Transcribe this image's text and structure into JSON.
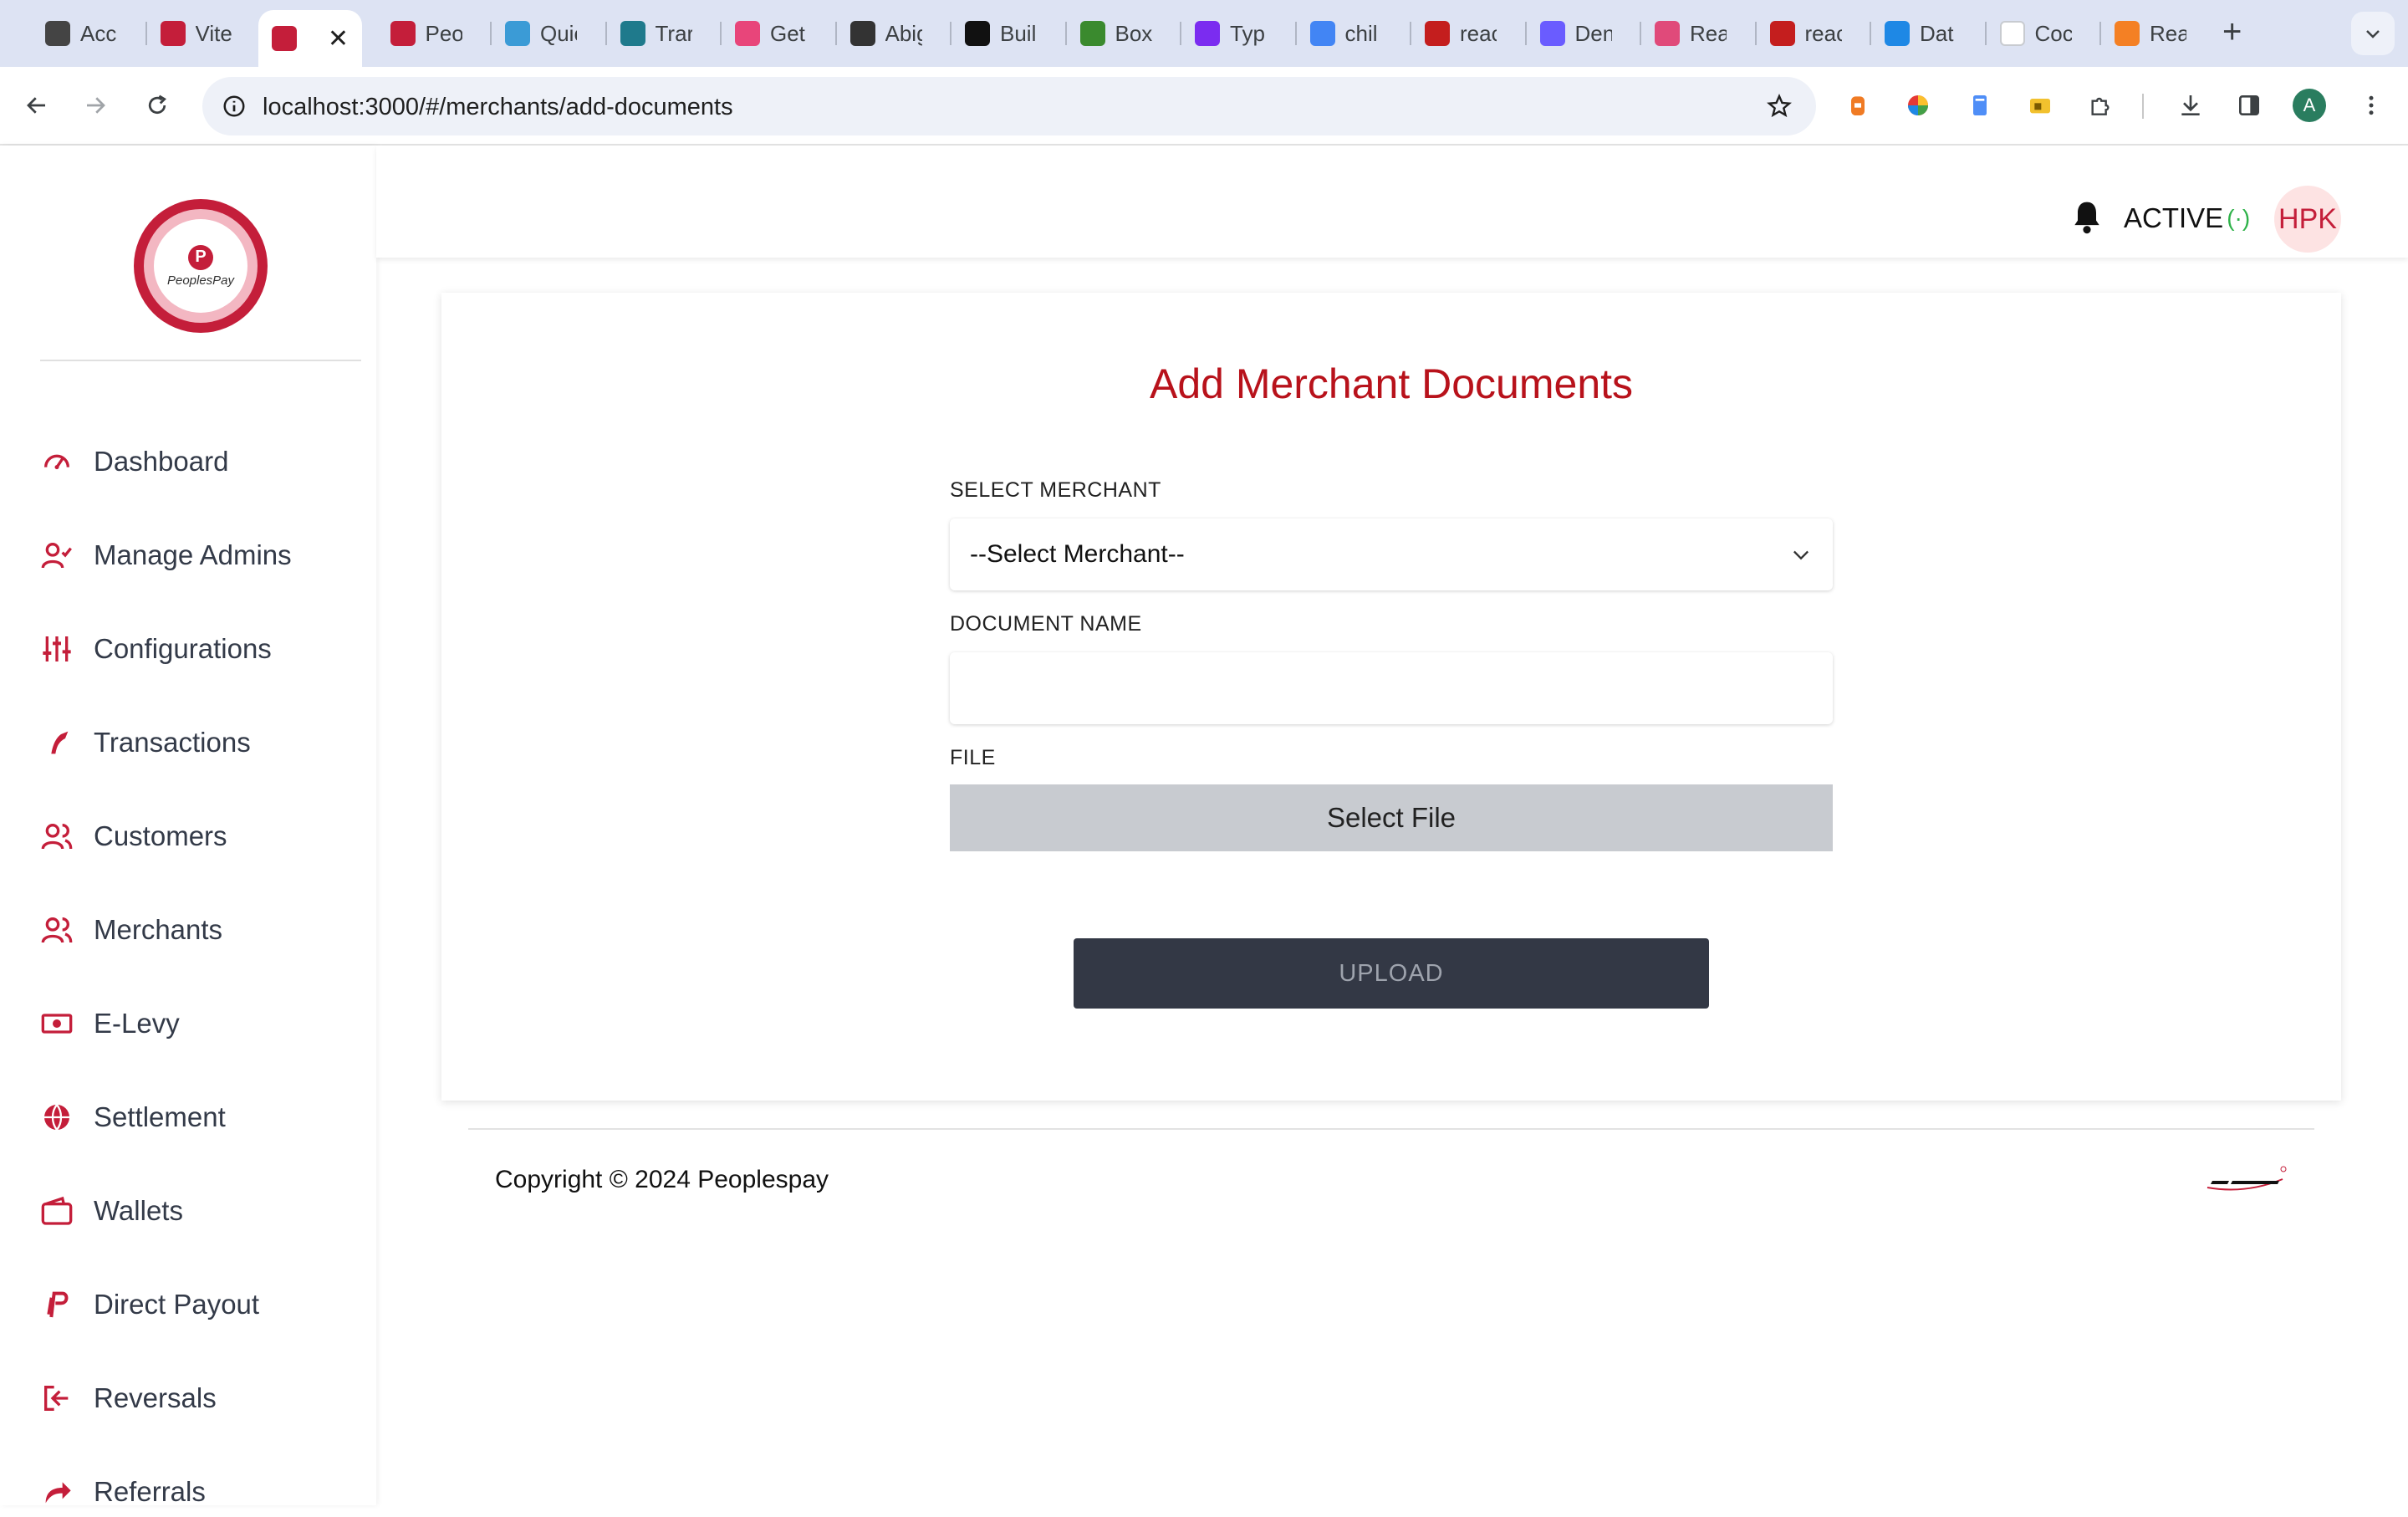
{
  "browser": {
    "tabs": [
      {
        "title": "Acc",
        "icon": "openai-icon",
        "color": "#444444"
      },
      {
        "title": "Vite",
        "icon": "peoplespay-icon",
        "color": "#c41e3a"
      },
      {
        "title": "",
        "icon": "peoplespay-icon",
        "color": "#c41e3a",
        "active": true
      },
      {
        "title": "Peo",
        "icon": "peoplespay-icon",
        "color": "#c41e3a"
      },
      {
        "title": "Quic",
        "icon": "react-icon",
        "color": "#3b9bd6"
      },
      {
        "title": "Trar",
        "icon": "transform-icon",
        "color": "#1f7a8c"
      },
      {
        "title": "Get",
        "icon": "app-icon",
        "color": "#e8457a"
      },
      {
        "title": "Abig",
        "icon": "github-icon",
        "color": "#333333"
      },
      {
        "title": "Buil",
        "icon": "nextjs-icon",
        "color": "#111111"
      },
      {
        "title": "Box",
        "icon": "box-icon",
        "color": "#3a8a2e"
      },
      {
        "title": "Typ",
        "icon": "bootstrap-icon",
        "color": "#7b2cf0"
      },
      {
        "title": "chil",
        "icon": "google-icon",
        "color": "#4285f4"
      },
      {
        "title": "reac",
        "icon": "npm-icon",
        "color": "#c41e1e"
      },
      {
        "title": "Den",
        "icon": "stripe-icon",
        "color": "#6a5cff"
      },
      {
        "title": "Rea",
        "icon": "react-icon",
        "color": "#e04a7a"
      },
      {
        "title": "reac",
        "icon": "npm-icon",
        "color": "#c41e1e"
      },
      {
        "title": "Dat",
        "icon": "mui-icon",
        "color": "#1e88e5"
      },
      {
        "title": "Coc",
        "icon": "blank-icon",
        "color": "#ffffff"
      },
      {
        "title": "Rea",
        "icon": "stack-icon",
        "color": "#f48024"
      }
    ],
    "active_close": "✕",
    "url": "localhost:3000/#/merchants/add-documents",
    "profile_initial": "A"
  },
  "sidebar": {
    "logo_text": "PeoplesPay",
    "items": [
      {
        "label": "Dashboard",
        "icon": "dashboard-gauge-icon"
      },
      {
        "label": "Manage Admins",
        "icon": "user-check-icon"
      },
      {
        "label": "Configurations",
        "icon": "sliders-icon"
      },
      {
        "label": "Transactions",
        "icon": "transactions-icon"
      },
      {
        "label": "Customers",
        "icon": "users-icon"
      },
      {
        "label": "Merchants",
        "icon": "users-icon"
      },
      {
        "label": "E-Levy",
        "icon": "money-bill-icon"
      },
      {
        "label": "Settlement",
        "icon": "globe-icon"
      },
      {
        "label": "Wallets",
        "icon": "wallet-icon"
      },
      {
        "label": "Direct Payout",
        "icon": "paypal-icon"
      },
      {
        "label": "Reversals",
        "icon": "sign-out-icon"
      },
      {
        "label": "Referrals",
        "icon": "share-icon"
      }
    ]
  },
  "header": {
    "status": "ACTIVE",
    "status_signal": "(·)",
    "avatar_initials": "HPK"
  },
  "form": {
    "title": "Add Merchant Documents",
    "merchant_label": "SELECT MERCHANT",
    "merchant_value": "--Select Merchant--",
    "document_label": "DOCUMENT NAME",
    "document_value": "",
    "file_label": "FILE",
    "file_button": "Select File",
    "upload_button": "UPLOAD"
  },
  "footer": {
    "copyright": "Copyright © 2024 Peoplespay"
  },
  "colors": {
    "brand_red": "#c41e3a",
    "title_red": "#b8121b",
    "upload_bg": "#333845",
    "active_green": "#2fb24a"
  }
}
